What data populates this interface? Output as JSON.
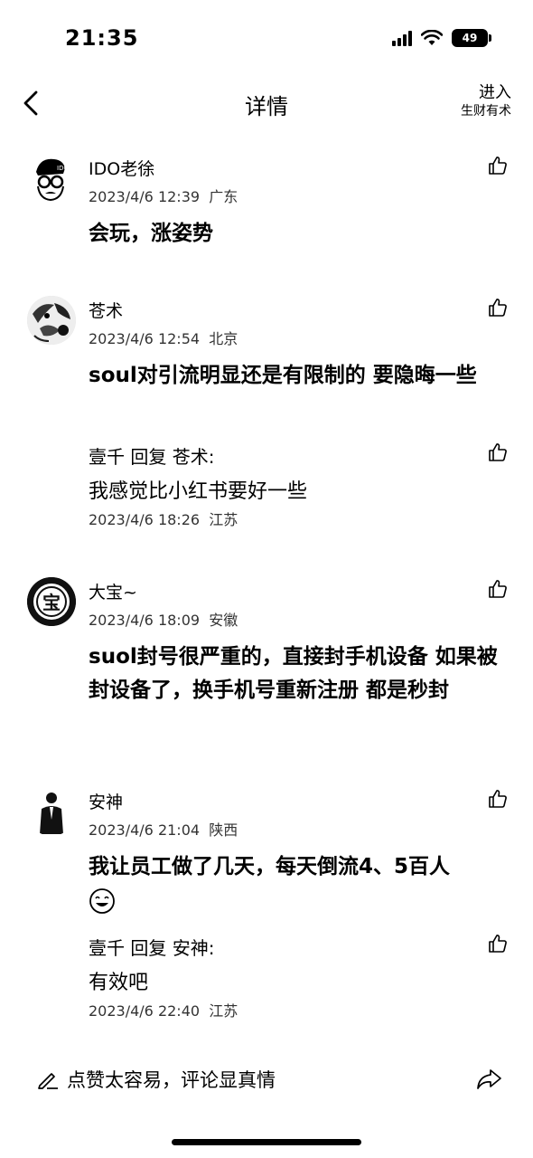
{
  "status": {
    "time": "21:35",
    "battery": "49"
  },
  "nav": {
    "title": "详情",
    "enter_line1": "进入",
    "enter_line2": "生财有术"
  },
  "comments": [
    {
      "name": "IDO老徐",
      "meta": "2023/4/6 12:39  广东",
      "text": "会玩，涨姿势",
      "avatar_text": "IDO"
    },
    {
      "name": "苍术",
      "meta": "2023/4/6 12:54  北京",
      "text": "soul对引流明显还是有限制的 要隐晦一些",
      "reply": {
        "head": "壹千 回复 苍术:",
        "text": "我感觉比小红书要好一些",
        "meta": "2023/4/6 18:26  江苏"
      }
    },
    {
      "name": "大宝~",
      "meta": "2023/4/6 18:09  安徽",
      "text": "suol封号很严重的，直接封手机设备 如果被封设备了，换手机号重新注册 都是秒封",
      "avatar_text": "宝"
    },
    {
      "name": "安神",
      "meta": "2023/4/6 21:04  陕西",
      "text": "我让员工做了几天，每天倒流4、5百人",
      "reply": {
        "head": "壹千 回复 安神:",
        "text": "有效吧",
        "meta": "2023/4/6 22:40  江苏"
      }
    }
  ],
  "footer": {
    "placeholder": "点赞太容易，评论显真情"
  }
}
